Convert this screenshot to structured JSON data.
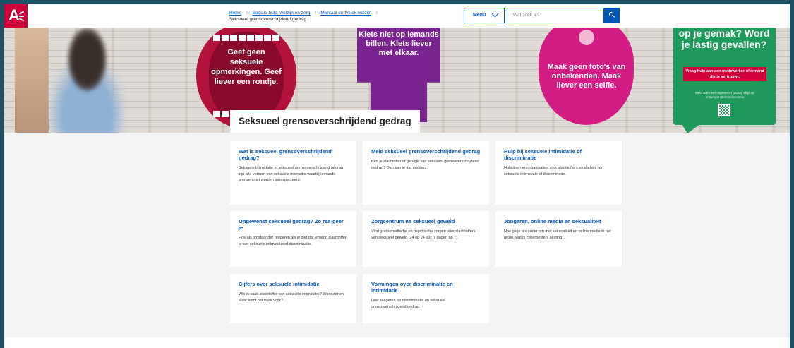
{
  "header": {
    "logo_text": "A",
    "breadcrumb": [
      "Home",
      "Sociale hulp, welzijn en zorg",
      "Mentaal en fysiek welzijn"
    ],
    "current_page": "Seksueel grensoverschrijdend gedrag",
    "menu_label": "Menu",
    "search_placeholder": "Wat zoek je?"
  },
  "hero": {
    "poster_mouth": "Geef geen seksuele opmerkingen. Geef liever een rondje.",
    "poster_shirt": "Klets niet op iemands billen. Klets liever met elkaar.",
    "poster_eye": "Maak geen foto's van onbekenden. Maak liever een selfie.",
    "poster_green_title": "op je gemak? Word je lastig gevallen?",
    "poster_green_tag": "Vraag hulp aan een medewerker of iemand die je vertrouwt.",
    "poster_green_small": "Meld seksueel ongewenst gedrag altijd op antwerpen.be/meldsexisme",
    "title": "Seksueel grensoverschrijdend gedrag"
  },
  "cards": [
    {
      "title": "Wat is seksueel grensoverschrijdend gedrag?",
      "text": "Seksuele intimidatie of seksueel grensoverschrijdend gedrag zijn alle vormen van seksuele interactie waarbij iemands grenzen niet worden gerespecteerd."
    },
    {
      "title": "Meld seksueel grensoverschrijdend gedrag",
      "text": "Ben je slachtoffer of getuige van seksueel grensoverschrijdend gedrag? Dan kan je dat melden."
    },
    {
      "title": "Hulp bij seksuele intimidatie of discriminatie",
      "text": "Hulplijnen en organisaties voor slachtoffers en daders van seksuele intimidatie of discriminatie."
    },
    {
      "title": "Ongewenst seksueel gedrag? Zo rea-geer je",
      "text": "Hoe als omstaander reageren als je ziet dat iemand slachtoffer is van seksuele intimidatie of discriminatie."
    },
    {
      "title": "Zorgcentrum na seksueel geweld",
      "text": "Vind gratis medische en psychische zorgen voor slachtoffers van seksueel geweld (24 op 24 uur, 7 dagen op 7)."
    },
    {
      "title": "Jongeren, online media en seksualiteit",
      "text": "Hoe ga je als ouder om met seksualiteit en online media in het gezin, wat is cyberpesten, sexting..."
    },
    {
      "title": "Cijfers over seksuele intimidatie",
      "text": "Wie is vaak slachtoffer van seksuele intimidatie? Wanneer en waar komt het vaak voor?"
    },
    {
      "title": "Vormingen over discriminatie en intimidatie",
      "text": "Leer reageren op discriminatie en seksueel grensoverschrijdend gedrag."
    }
  ],
  "colors": {
    "brand_red": "#cf0039",
    "link_blue": "#0057b8",
    "window_frame": "#1e4f63"
  }
}
